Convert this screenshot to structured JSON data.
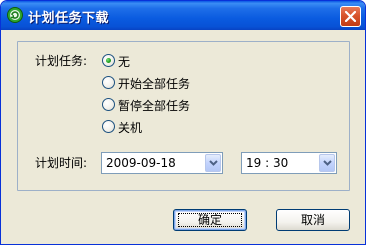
{
  "window": {
    "title": "计划任务下载",
    "icon": "refresh-globe-icon"
  },
  "schedule": {
    "task_label": "计划任务:",
    "options": [
      {
        "label": "无",
        "selected": true
      },
      {
        "label": "开始全部任务",
        "selected": false
      },
      {
        "label": "暂停全部任务",
        "selected": false
      },
      {
        "label": "关机",
        "selected": false
      }
    ],
    "time_label": "计划时间:",
    "date_value": "2009-09-18",
    "time_value": "19 : 30"
  },
  "buttons": {
    "ok": "确定",
    "cancel": "取消"
  }
}
